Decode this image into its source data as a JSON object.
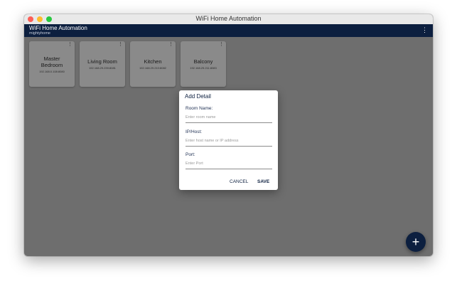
{
  "window": {
    "title": "WiFi Home Automation"
  },
  "appbar": {
    "title": "WiFi Home Automation",
    "subtitle": "mightyhome",
    "menu_icon": "more-vertical-icon"
  },
  "rooms": [
    {
      "name": "Master Bedroom",
      "ip": "192.168.0.108:8080"
    },
    {
      "name": "Living Room",
      "ip": "192.168.29.239:8081"
    },
    {
      "name": "Kitchen",
      "ip": "192.168.29.210:8082"
    },
    {
      "name": "Balcony",
      "ip": "192.168.29.211:8083"
    }
  ],
  "dialog": {
    "title": "Add Detail",
    "room_name_label": "Room Name:",
    "room_name_placeholder": "Enter room name",
    "host_label": "IP/Host:",
    "host_placeholder": "Enter host name or IP address",
    "port_label": "Port:",
    "port_placeholder": "Enter Port",
    "cancel_label": "CANCEL",
    "save_label": "SAVE"
  },
  "fab": {
    "icon": "plus-icon",
    "symbol": "+"
  },
  "colors": {
    "primary": "#0c1f3f",
    "background": "#6e6e6e",
    "card": "#8a8a8a",
    "dialog": "#ffffff"
  }
}
